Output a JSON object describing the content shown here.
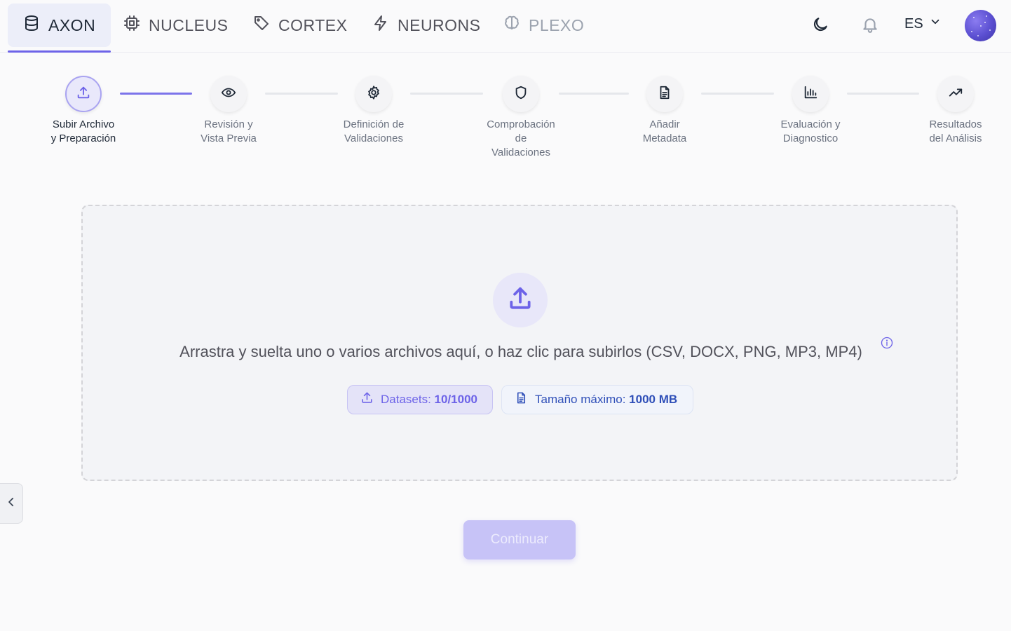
{
  "nav": {
    "tabs": [
      {
        "label": "AXON",
        "icon": "database-icon"
      },
      {
        "label": "NUCLEUS",
        "icon": "cpu-icon"
      },
      {
        "label": "CORTEX",
        "icon": "tag-icon"
      },
      {
        "label": "NEURONS",
        "icon": "bolt-icon"
      },
      {
        "label": "PLEXO",
        "icon": "brain-icon"
      }
    ],
    "active_tab": "AXON",
    "language": "ES"
  },
  "stepper": {
    "steps": [
      {
        "label_line1": "Subir Archivo",
        "label_line2": "y Preparación",
        "label_line3": "",
        "icon": "upload-icon"
      },
      {
        "label_line1": "Revisión y",
        "label_line2": "Vista Previa",
        "label_line3": "",
        "icon": "eye-icon"
      },
      {
        "label_line1": "Definición de",
        "label_line2": "Validaciones",
        "label_line3": "",
        "icon": "gear-icon"
      },
      {
        "label_line1": "Comprobación",
        "label_line2": "de",
        "label_line3": "Validaciones",
        "icon": "shield-icon"
      },
      {
        "label_line1": "Añadir",
        "label_line2": "Metadata",
        "label_line3": "",
        "icon": "document-icon"
      },
      {
        "label_line1": "Evaluación y",
        "label_line2": "Diagnostico",
        "label_line3": "",
        "icon": "bar-chart-icon"
      },
      {
        "label_line1": "Resultados",
        "label_line2": "del Análisis",
        "label_line3": "",
        "icon": "trending-up-icon"
      }
    ],
    "current_step": 1
  },
  "dropzone": {
    "instruction": "Arrastra y suelta uno o varios archivos aquí, o haz clic para subirlos (CSV, DOCX, PNG, MP3, MP4)",
    "datasets_label": "Datasets: ",
    "datasets_value": "10/1000",
    "max_size_label": "Tamaño máximo: ",
    "max_size_value": "1000 MB"
  },
  "actions": {
    "continue_label": "Continuar"
  },
  "colors": {
    "accent": "#6d63e8",
    "accent_light": "#e9e8fb",
    "size_blue": "#2f4fb8"
  }
}
